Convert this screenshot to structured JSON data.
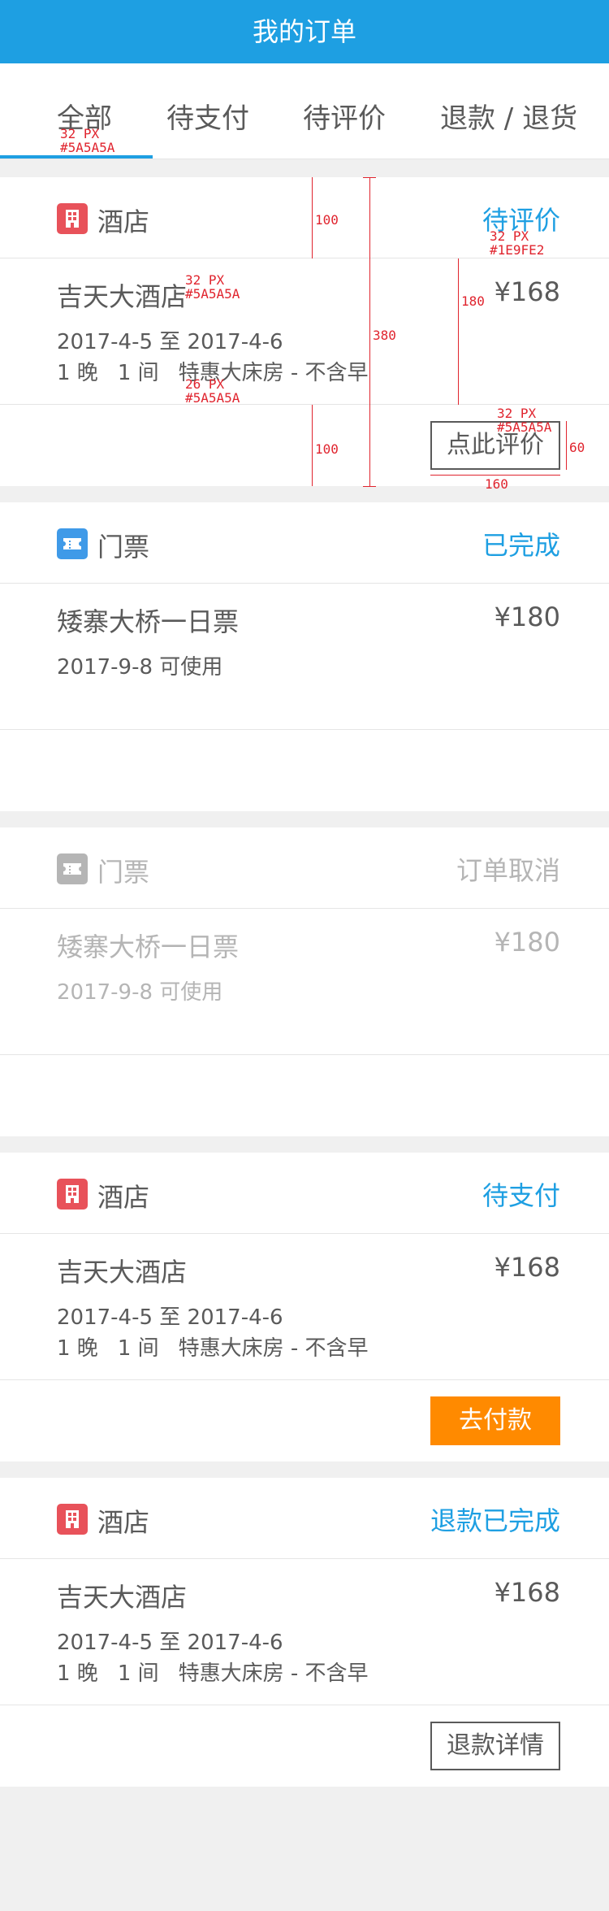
{
  "header": {
    "title": "我的订单"
  },
  "tabs": [
    {
      "label": "全部",
      "active": true
    },
    {
      "label": "待支付",
      "active": false
    },
    {
      "label": "待评价",
      "active": false
    },
    {
      "label": "退款 / 退货",
      "active": false
    }
  ],
  "orders": [
    {
      "type": "酒店",
      "icon": "hotel-icon",
      "status": "待评价",
      "name": "吉天大酒店",
      "price": "¥168",
      "dates": "2017-4-5 至 2017-4-6",
      "nights": "1 晚",
      "rooms": "1 间",
      "room_type": "特惠大床房 - 不含早",
      "button": "点此评价"
    },
    {
      "type": "门票",
      "icon": "ticket-icon",
      "status": "已完成",
      "name": "矮寨大桥一日票",
      "price": "¥180",
      "usage": "2017-9-8 可使用"
    },
    {
      "type": "门票",
      "icon": "ticket-icon",
      "status": "订单取消",
      "name": "矮寨大桥一日票",
      "price": "¥180",
      "usage": "2017-9-8 可使用"
    },
    {
      "type": "酒店",
      "icon": "hotel-icon",
      "status": "待支付",
      "name": "吉天大酒店",
      "price": "¥168",
      "dates": "2017-4-5 至 2017-4-6",
      "nights": "1 晚",
      "rooms": "1 间",
      "room_type": "特惠大床房 - 不含早",
      "button": "去付款"
    },
    {
      "type": "酒店",
      "icon": "hotel-icon",
      "status": "退款已完成",
      "name": "吉天大酒店",
      "price": "¥168",
      "dates": "2017-4-5 至 2017-4-6",
      "nights": "1 晚",
      "rooms": "1 间",
      "room_type": "特惠大床房 - 不含早",
      "button": "退款详情"
    }
  ],
  "annotations": {
    "tab_font": "32 PX",
    "tab_color": "#5A5A5A",
    "name_font": "32 PX",
    "name_color": "#5A5A5A",
    "detail_font": "26 PX",
    "detail_color": "#5A5A5A",
    "status_font": "32 PX",
    "status_color": "#1E9FE2",
    "btn_font": "32 PX",
    "btn_color": "#5A5A5A",
    "head_height": "100",
    "body_height": "180",
    "card_height": "380",
    "foot_height": "100",
    "btn_height": "60",
    "btn_width": "160"
  },
  "colors": {
    "accent": "#1E9FE2",
    "text": "#5A5A5A",
    "hotel": "#E8525A",
    "ticket": "#3F9AE8",
    "pay": "#FF8A00",
    "annotation": "#E0242E"
  }
}
